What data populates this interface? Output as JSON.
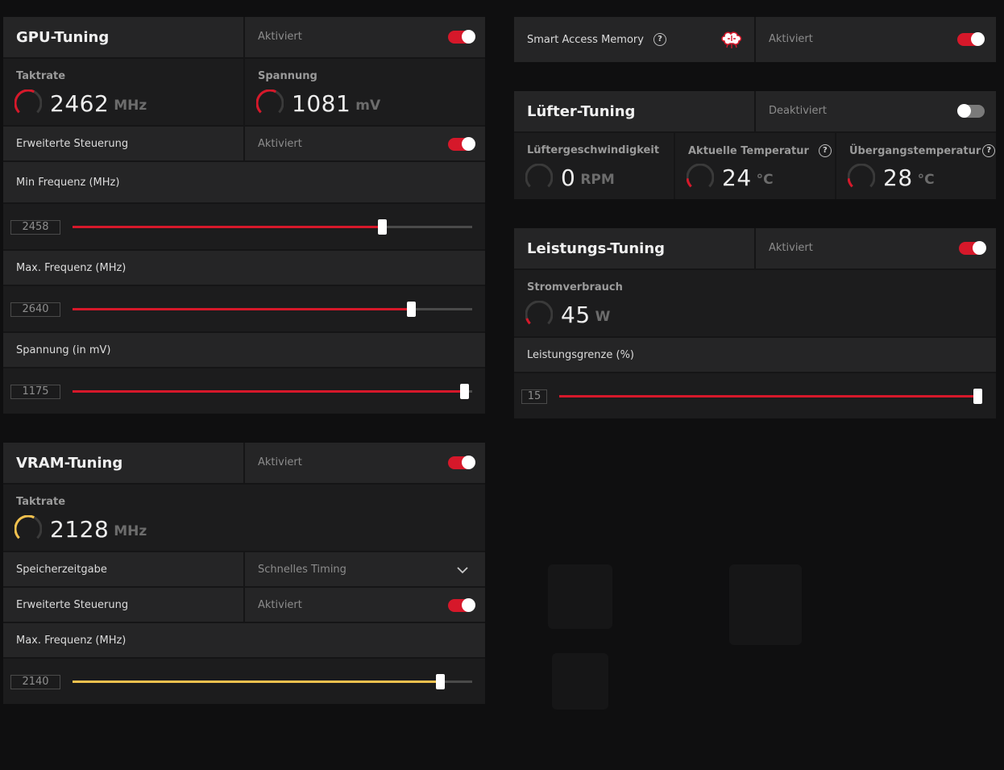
{
  "gpu_tuning": {
    "title": "GPU-Tuning",
    "status": "Aktiviert",
    "enabled": true,
    "clock": {
      "label": "Taktrate",
      "value": "2462",
      "unit": "MHz",
      "level": 0.6
    },
    "voltage": {
      "label": "Spannung",
      "value": "1081",
      "unit": "mV",
      "level": 0.6
    },
    "advanced": {
      "label": "Erweiterte Steuerung",
      "status": "Aktiviert",
      "enabled": true
    },
    "sliders": [
      {
        "label": "Min Frequenz (MHz)",
        "value": "2458",
        "fraction": 0.775
      },
      {
        "label": "Max. Frequenz (MHz)",
        "value": "2640",
        "fraction": 0.847
      },
      {
        "label": "Spannung (in mV)",
        "value": "1175",
        "fraction": 0.98
      }
    ]
  },
  "vram_tuning": {
    "title": "VRAM-Tuning",
    "status": "Aktiviert",
    "enabled": true,
    "clock": {
      "label": "Taktrate",
      "value": "2128",
      "unit": "MHz",
      "level": 0.6
    },
    "timing": {
      "label": "Speicherzeitgabe",
      "value": "Schnelles Timing"
    },
    "advanced": {
      "label": "Erweiterte Steuerung",
      "status": "Aktiviert",
      "enabled": true
    },
    "slider": {
      "label": "Max. Frequenz (MHz)",
      "value": "2140",
      "fraction": 0.92
    }
  },
  "sam": {
    "label": "Smart Access Memory",
    "status": "Aktiviert",
    "enabled": true
  },
  "fan_tuning": {
    "title": "Lüfter-Tuning",
    "status": "Deaktiviert",
    "enabled": false,
    "speed": {
      "label": "Lüftergeschwindigkeit",
      "value": "0",
      "unit": "RPM",
      "level": 0
    },
    "temp": {
      "label": "Aktuelle Temperatur",
      "value": "24",
      "unit": "°C",
      "level": 0.15
    },
    "junction": {
      "label": "Übergangstemperatur",
      "value": "28",
      "unit": "°C",
      "level": 0.15
    }
  },
  "power_tuning": {
    "title": "Leistungs-Tuning",
    "status": "Aktiviert",
    "enabled": true,
    "power": {
      "label": "Stromverbrauch",
      "value": "45",
      "unit": "W",
      "level": 0.1
    },
    "limit": {
      "label": "Leistungsgrenze (%)",
      "value": "15",
      "fraction": 0.99
    }
  },
  "colors": {
    "accent_red": "#d6182a",
    "accent_yellow": "#f2c14e",
    "panel": "#252526",
    "background": "#0f0f10"
  },
  "icons": {
    "help": "?",
    "sam": "brain-chip-icon",
    "dropdown": "chevron-down-icon"
  }
}
